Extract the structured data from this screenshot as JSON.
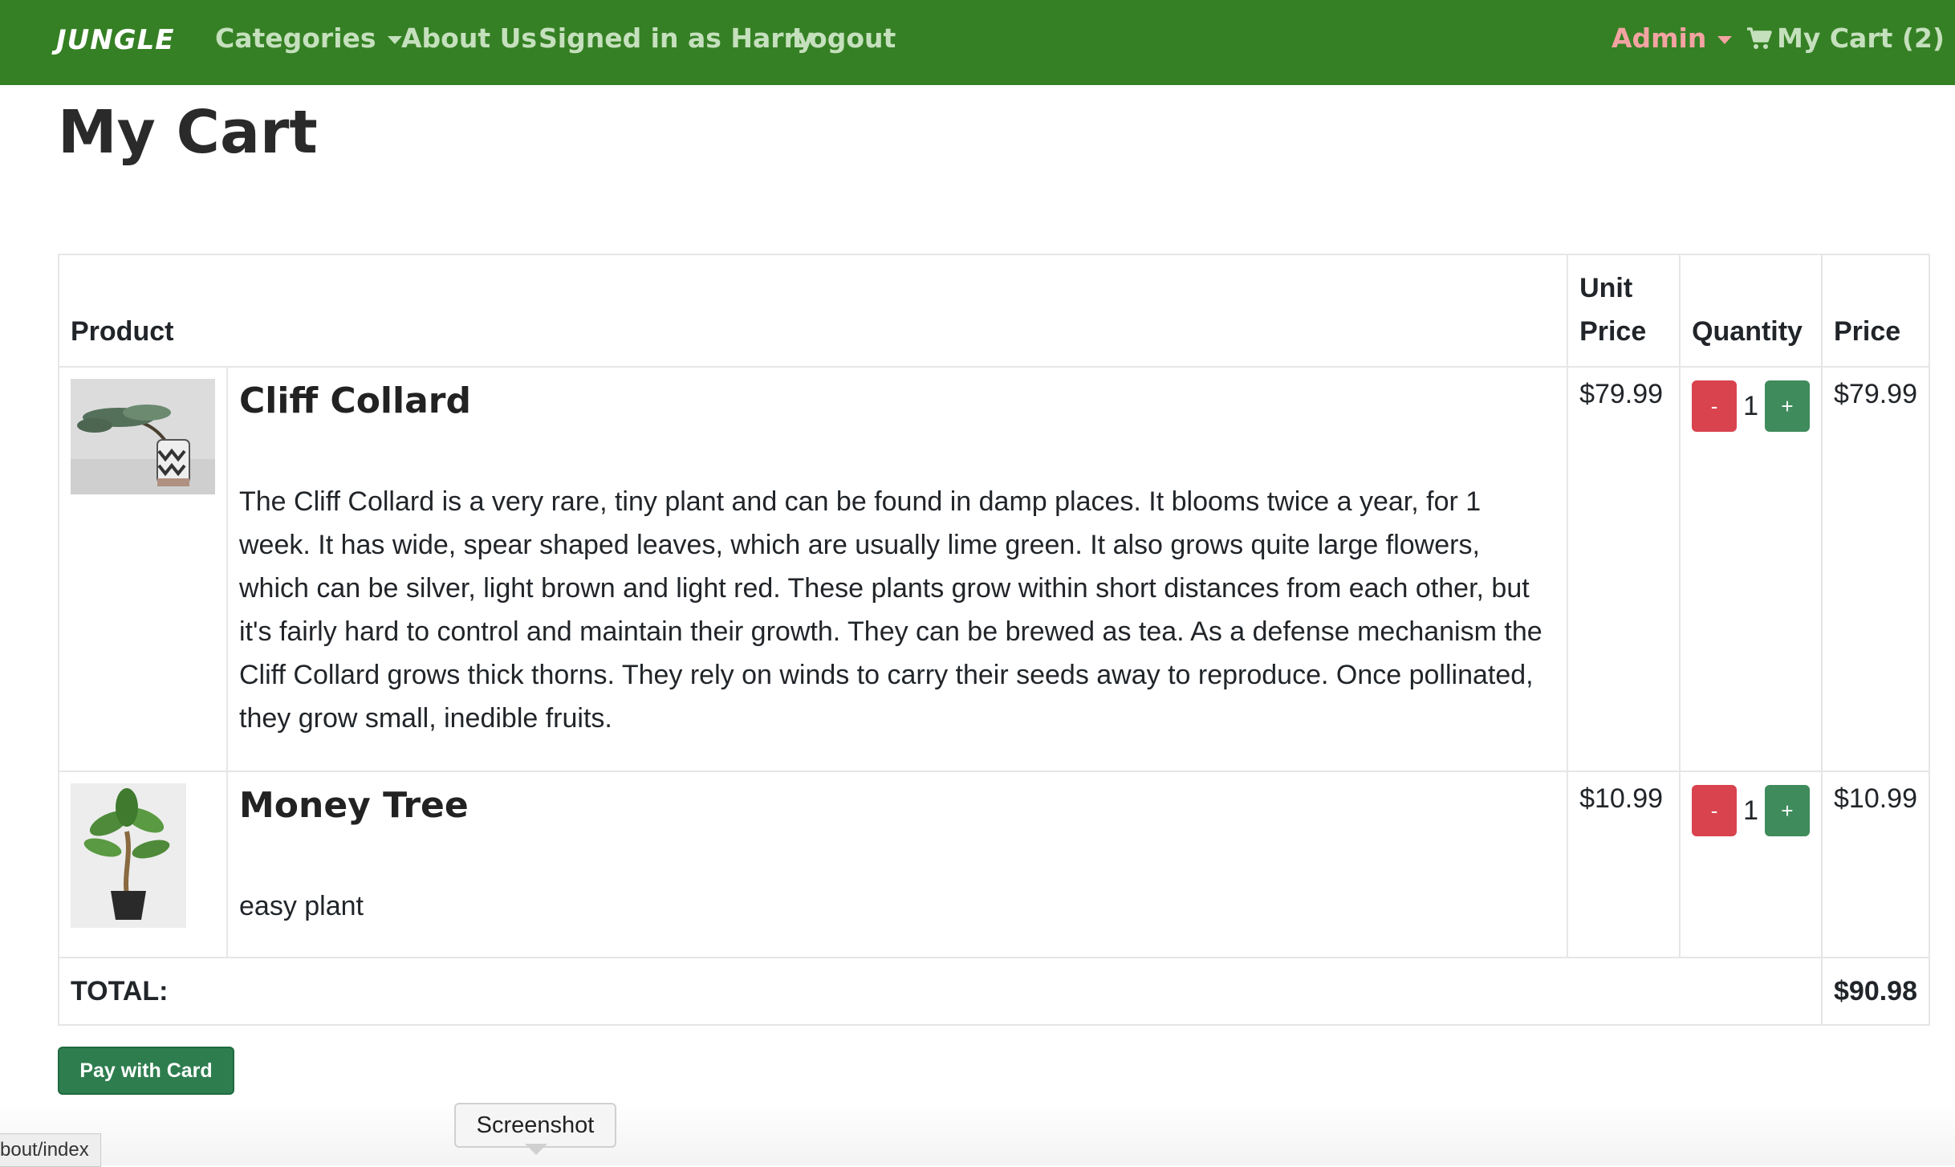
{
  "nav": {
    "brand": "JUNGLE",
    "categories": "Categories",
    "about": "About Us",
    "signed_in": "Signed in as Harry",
    "logout": "Logout",
    "admin": "Admin",
    "cart": "My Cart (2)"
  },
  "page_title": "My Cart",
  "table": {
    "headers": {
      "product": "Product",
      "unit_price_line1": "Unit",
      "unit_price_line2": "Price",
      "quantity": "Quantity",
      "price": "Price"
    },
    "rows": [
      {
        "name": "Cliff Collard",
        "description": "The Cliff Collard is a very rare, tiny plant and can be found in damp places. It blooms twice a year, for 1 week. It has wide, spear shaped leaves, which are usually lime green. It also grows quite large flowers, which can be silver, light brown and light red. These plants grow within short distances from each other, but it's fairly hard to control and maintain their growth. They can be brewed as tea. As a defense mechanism the Cliff Collard grows thick thorns. They rely on winds to carry their seeds away to reproduce. Once pollinated, they grow small, inedible fruits.",
        "unit_price": "$79.99",
        "quantity": "1",
        "price": "$79.99"
      },
      {
        "name": "Money Tree",
        "description": "easy plant",
        "unit_price": "$10.99",
        "quantity": "1",
        "price": "$10.99"
      }
    ],
    "minus_label": "-",
    "plus_label": "+",
    "total_label": "TOTAL:",
    "total_value": "$90.98"
  },
  "pay_button": "Pay with Card",
  "status_url": "bout/index",
  "tooltip": "Screenshot",
  "colors": {
    "navbar": "#358024",
    "minus_button": "#d9434e",
    "plus_button": "#3f8b5c",
    "pay_button": "#2e7d4f",
    "admin": "#f4a3a3"
  }
}
